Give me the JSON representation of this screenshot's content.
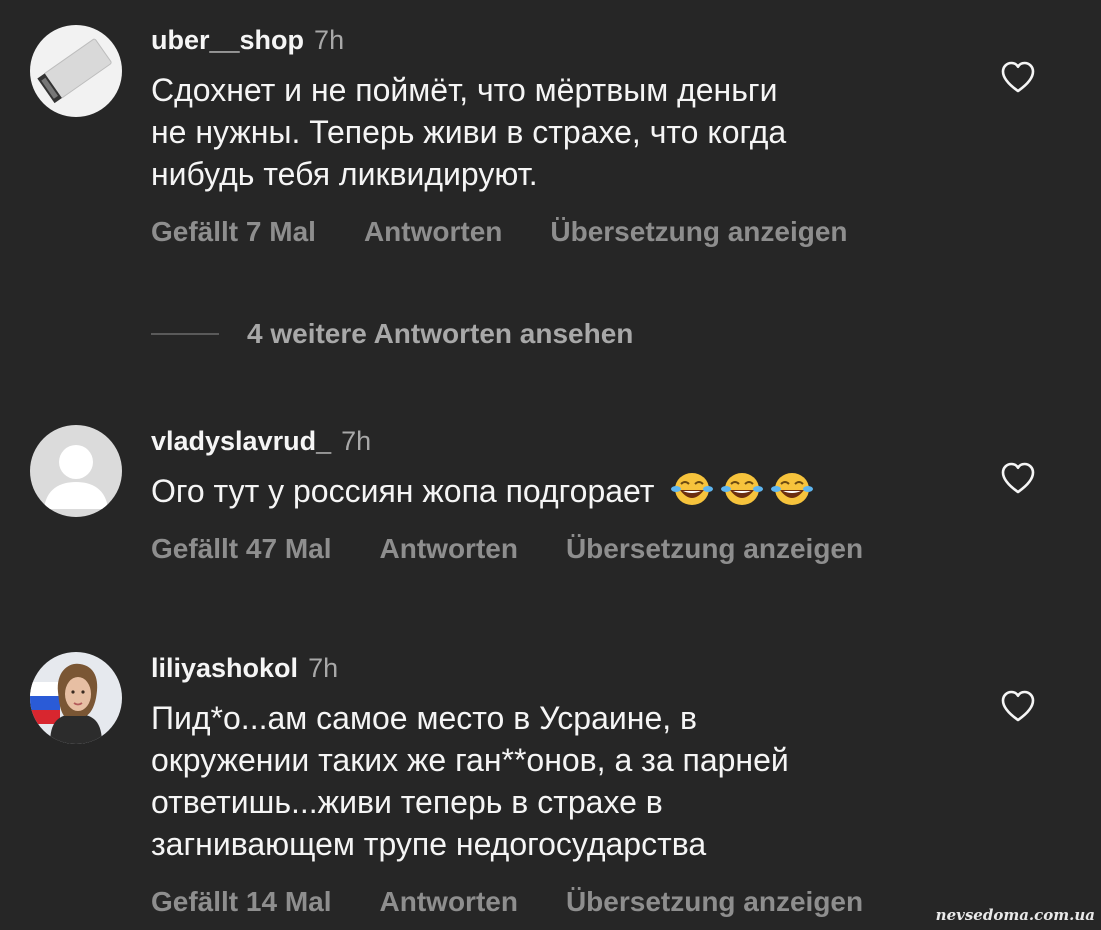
{
  "comments": [
    {
      "username": "uber__shop",
      "time": "7h",
      "text": "Сдохнет и не поймёт, что мёртвым деньги\nне нужны. Теперь живи в страхе, что когда\nнибудь тебя ликвидируют.",
      "likes": "Gefällt 7 Mal",
      "reply": "Antworten",
      "translate": "Übersetzung anzeigen"
    },
    {
      "username": "vladyslavrud_",
      "time": "7h",
      "text": "Ого тут у россиян жопа подгорает",
      "emoji_count": 3,
      "likes": "Gefällt 47 Mal",
      "reply": "Antworten",
      "translate": "Übersetzung anzeigen"
    },
    {
      "username": "liliyashokol",
      "time": "7h",
      "text": "Пид*о...ам самое место в Усраине, в\nокружении таких же ган**онов, а за парней\nответишь...живи теперь в страхе в\nзагнивающем трупе недогосударства",
      "likes": "Gefällt 14 Mal",
      "reply": "Antworten",
      "translate": "Übersetzung anzeigen"
    }
  ],
  "more_replies": "4 weitere Antworten ansehen",
  "watermark": "nevsedoma.com.ua",
  "colors": {
    "background": "#262626",
    "text": "#f5f5f5",
    "muted": "#8e8e8e"
  },
  "icons": [
    "heart-outline-icon",
    "tears-of-joy-emoji"
  ]
}
